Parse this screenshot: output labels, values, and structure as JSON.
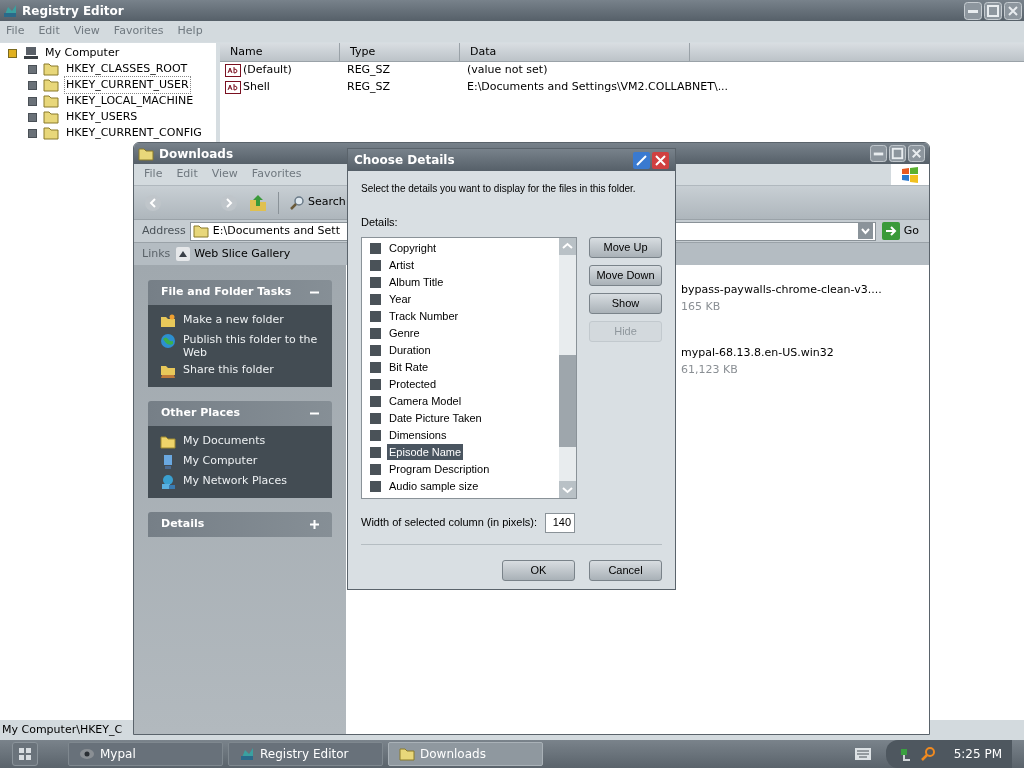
{
  "registry_editor": {
    "title": "Registry Editor",
    "menu": [
      "File",
      "Edit",
      "View",
      "Favorites",
      "Help"
    ],
    "tree": {
      "label": "My Computer",
      "expanded": true,
      "children": [
        {
          "label": "HKEY_CLASSES_ROOT",
          "selected": false
        },
        {
          "label": "HKEY_CURRENT_USER",
          "selected": true
        },
        {
          "label": "HKEY_LOCAL_MACHINE",
          "selected": false
        },
        {
          "label": "HKEY_USERS",
          "selected": false
        },
        {
          "label": "HKEY_CURRENT_CONFIG",
          "selected": false
        }
      ]
    },
    "columns": [
      "Name",
      "Type",
      "Data"
    ],
    "rows": [
      {
        "name": "(Default)",
        "type": "REG_SZ",
        "data": "(value not set)"
      },
      {
        "name": "Shell",
        "type": "REG_SZ",
        "data": "E:\\Documents and Settings\\VM2.COLLABNET\\..."
      }
    ],
    "status_bar": "My Computer\\HKEY_C"
  },
  "downloads": {
    "title": "Downloads",
    "menu": [
      "File",
      "Edit",
      "View",
      "Favorites"
    ],
    "search": "Search",
    "address": {
      "label": "Address",
      "value": "E:\\Documents and Sett",
      "go": "Go"
    },
    "links": {
      "label": "Links",
      "items": [
        "Web Slice Gallery"
      ]
    },
    "task_panels": [
      {
        "title": "File and Folder Tasks",
        "expanded": true,
        "items": [
          {
            "label": "Make a new folder",
            "kind": "new-folder"
          },
          {
            "label": "Publish this folder to the Web",
            "kind": "globe"
          },
          {
            "label": "Share this folder",
            "kind": "share"
          }
        ]
      },
      {
        "title": "Other Places",
        "expanded": true,
        "items": [
          {
            "label": "My Documents",
            "kind": "folder"
          },
          {
            "label": "My Computer",
            "kind": "computer"
          },
          {
            "label": "My Network Places",
            "kind": "network"
          }
        ]
      },
      {
        "title": "Details",
        "expanded": false
      }
    ],
    "files": [
      {
        "name": "bypass-paywalls-chrome-clean-v3....",
        "size": "165 KB"
      },
      {
        "name": "mypal-68.13.8.en-US.win32",
        "size": "61,123 KB"
      }
    ]
  },
  "dialog": {
    "title": "Choose Details",
    "intro": "Select the details you want to display for the files in this folder.",
    "list_label": "Details:",
    "details": [
      {
        "label": "Copyright",
        "checked": false,
        "selected": false
      },
      {
        "label": "Artist",
        "checked": false,
        "selected": false
      },
      {
        "label": "Album Title",
        "checked": false,
        "selected": false
      },
      {
        "label": "Year",
        "checked": false,
        "selected": false
      },
      {
        "label": "Track Number",
        "checked": false,
        "selected": false
      },
      {
        "label": "Genre",
        "checked": false,
        "selected": false
      },
      {
        "label": "Duration",
        "checked": false,
        "selected": false
      },
      {
        "label": "Bit Rate",
        "checked": false,
        "selected": false
      },
      {
        "label": "Protected",
        "checked": false,
        "selected": false
      },
      {
        "label": "Camera Model",
        "checked": false,
        "selected": false
      },
      {
        "label": "Date Picture Taken",
        "checked": false,
        "selected": false
      },
      {
        "label": "Dimensions",
        "checked": false,
        "selected": false
      },
      {
        "label": "Episode Name",
        "checked": false,
        "selected": true
      },
      {
        "label": "Program Description",
        "checked": false,
        "selected": false
      },
      {
        "label": "Audio sample size",
        "checked": false,
        "selected": false
      }
    ],
    "side_buttons": [
      {
        "label": "Move Up",
        "disabled": false
      },
      {
        "label": "Move Down",
        "disabled": false
      },
      {
        "label": "Show",
        "disabled": false
      },
      {
        "label": "Hide",
        "disabled": true
      }
    ],
    "width_label": "Width of selected column (in pixels):",
    "width_value": "140",
    "buttons": [
      "OK",
      "Cancel"
    ]
  },
  "taskbar": {
    "tasks": [
      {
        "label": "Mypal",
        "selected": false,
        "kind": "mypal"
      },
      {
        "label": "Registry Editor",
        "selected": false,
        "kind": "registry"
      },
      {
        "label": "Downloads",
        "selected": true,
        "kind": "folder"
      }
    ],
    "clock": "5:25 PM"
  }
}
